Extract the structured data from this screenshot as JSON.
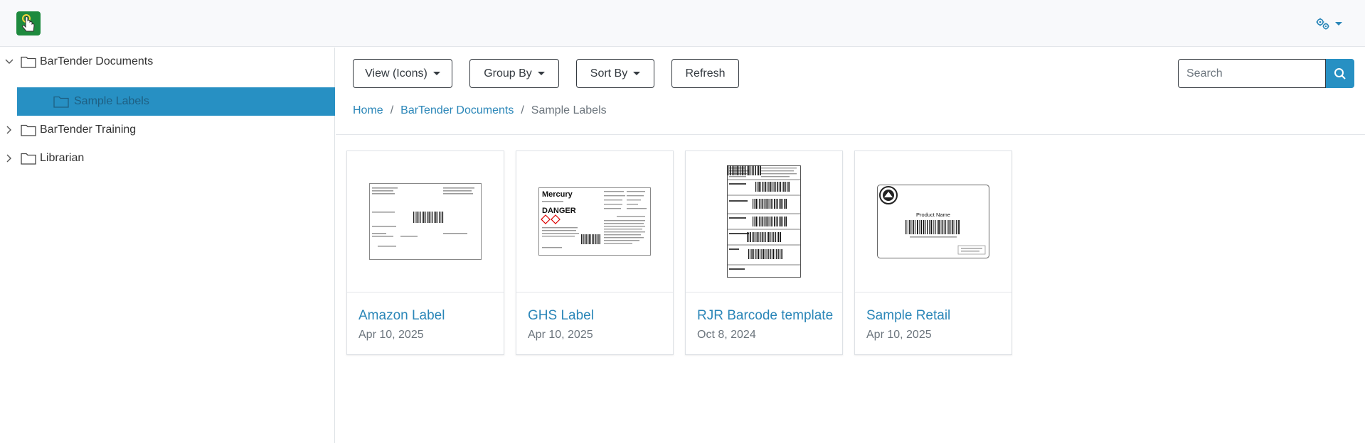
{
  "header": {
    "logo_icon": "touch-hand-icon",
    "settings_icon": "gears-icon",
    "accent": "#2790c3",
    "logo_color": "#1e8a3e"
  },
  "sidebar": {
    "items": [
      {
        "label": "BarTender Documents",
        "expanded": true
      },
      {
        "label": "Sample Labels",
        "selected": true
      },
      {
        "label": "BarTender Training",
        "expanded": false
      },
      {
        "label": "Librarian",
        "expanded": false
      }
    ]
  },
  "toolbar": {
    "view_label": "View (Icons)",
    "group_label": "Group By",
    "sort_label": "Sort By",
    "refresh_label": "Refresh",
    "search_placeholder": "Search"
  },
  "breadcrumb": {
    "home": "Home",
    "parent": "BarTender Documents",
    "current": "Sample Labels",
    "separator": "/"
  },
  "cards": [
    {
      "title": "Amazon Label",
      "date": "Apr 10, 2025"
    },
    {
      "title": "GHS Label",
      "date": "Apr 10, 2025",
      "thumb_heading": "Mercury",
      "thumb_warning": "DANGER"
    },
    {
      "title": "RJR Barcode template",
      "date": "Oct 8, 2024"
    },
    {
      "title": "Sample Retail",
      "date": "Apr 10, 2025",
      "thumb_heading": "Product Name"
    }
  ]
}
